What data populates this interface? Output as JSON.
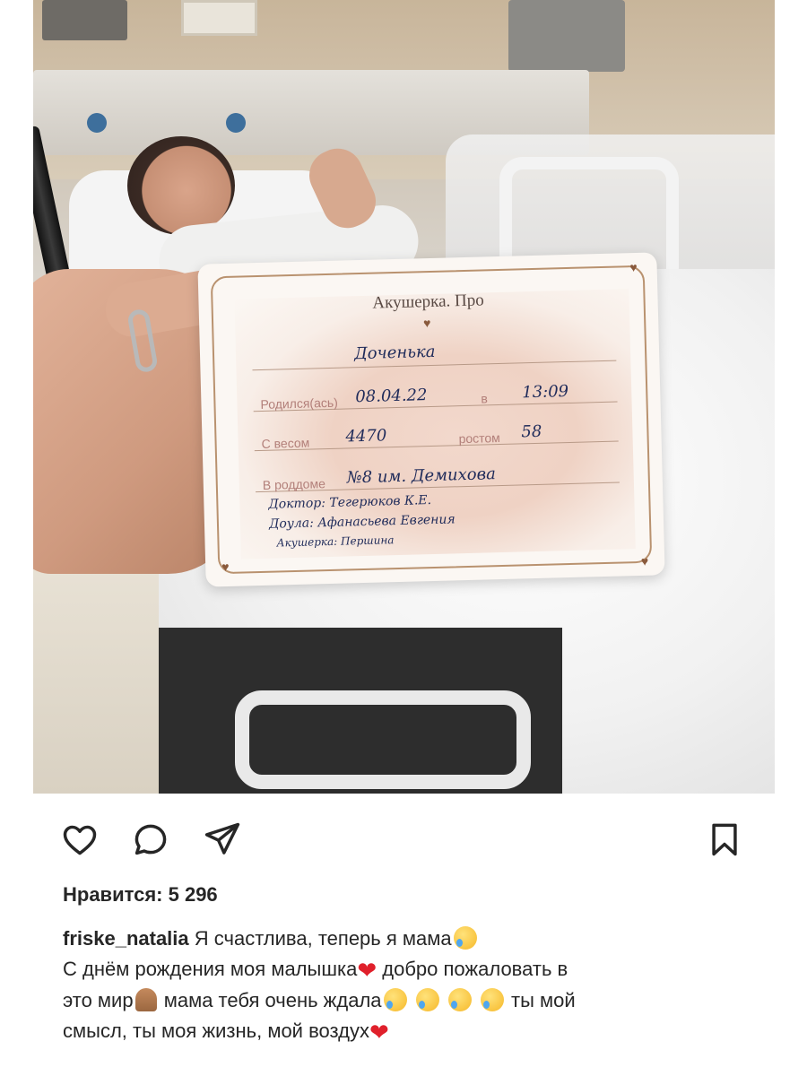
{
  "post": {
    "photo_alt": "",
    "card": {
      "title": "Акушерка. Про",
      "label_name": "",
      "label_born": "Родился(ась)",
      "label_at": "в",
      "label_weight": "С весом",
      "label_height": "ростом",
      "label_hospital": "В роддоме",
      "hw_name": "Доченька",
      "hw_date": "08.04.22",
      "hw_time": "13:09",
      "hw_weight": "4470",
      "hw_height": "58",
      "hw_hospital": "№8 им. Демихова",
      "hw_doctor": "Доктор: Тегерюков К.Е.",
      "hw_doula": "Доула: Афанасьева Евгения",
      "hw_midwife": "Акушерка: Першина"
    }
  },
  "actions": {
    "like_icon": "heart-outline-icon",
    "comment_icon": "speech-bubble-icon",
    "share_icon": "paper-plane-icon",
    "save_icon": "bookmark-icon"
  },
  "likes": {
    "text": "Нравится: 5 296"
  },
  "caption": {
    "username": "friske_natalia",
    "line1": "Я счастлива, теперь я мама",
    "line2": "С днём рождения моя малышка",
    "line2b": "добро пожаловать в",
    "line3": "это мир",
    "line3b": "мама тебя очень ждала",
    "line3c": "ты мой",
    "line4": "смысл, ты моя жизнь, мой воздух"
  },
  "colors": {
    "text": "#262626",
    "heart_emoji": "#e0202b",
    "card_bg": "#fbf7f3",
    "handwriting": "#1f2b5a"
  }
}
